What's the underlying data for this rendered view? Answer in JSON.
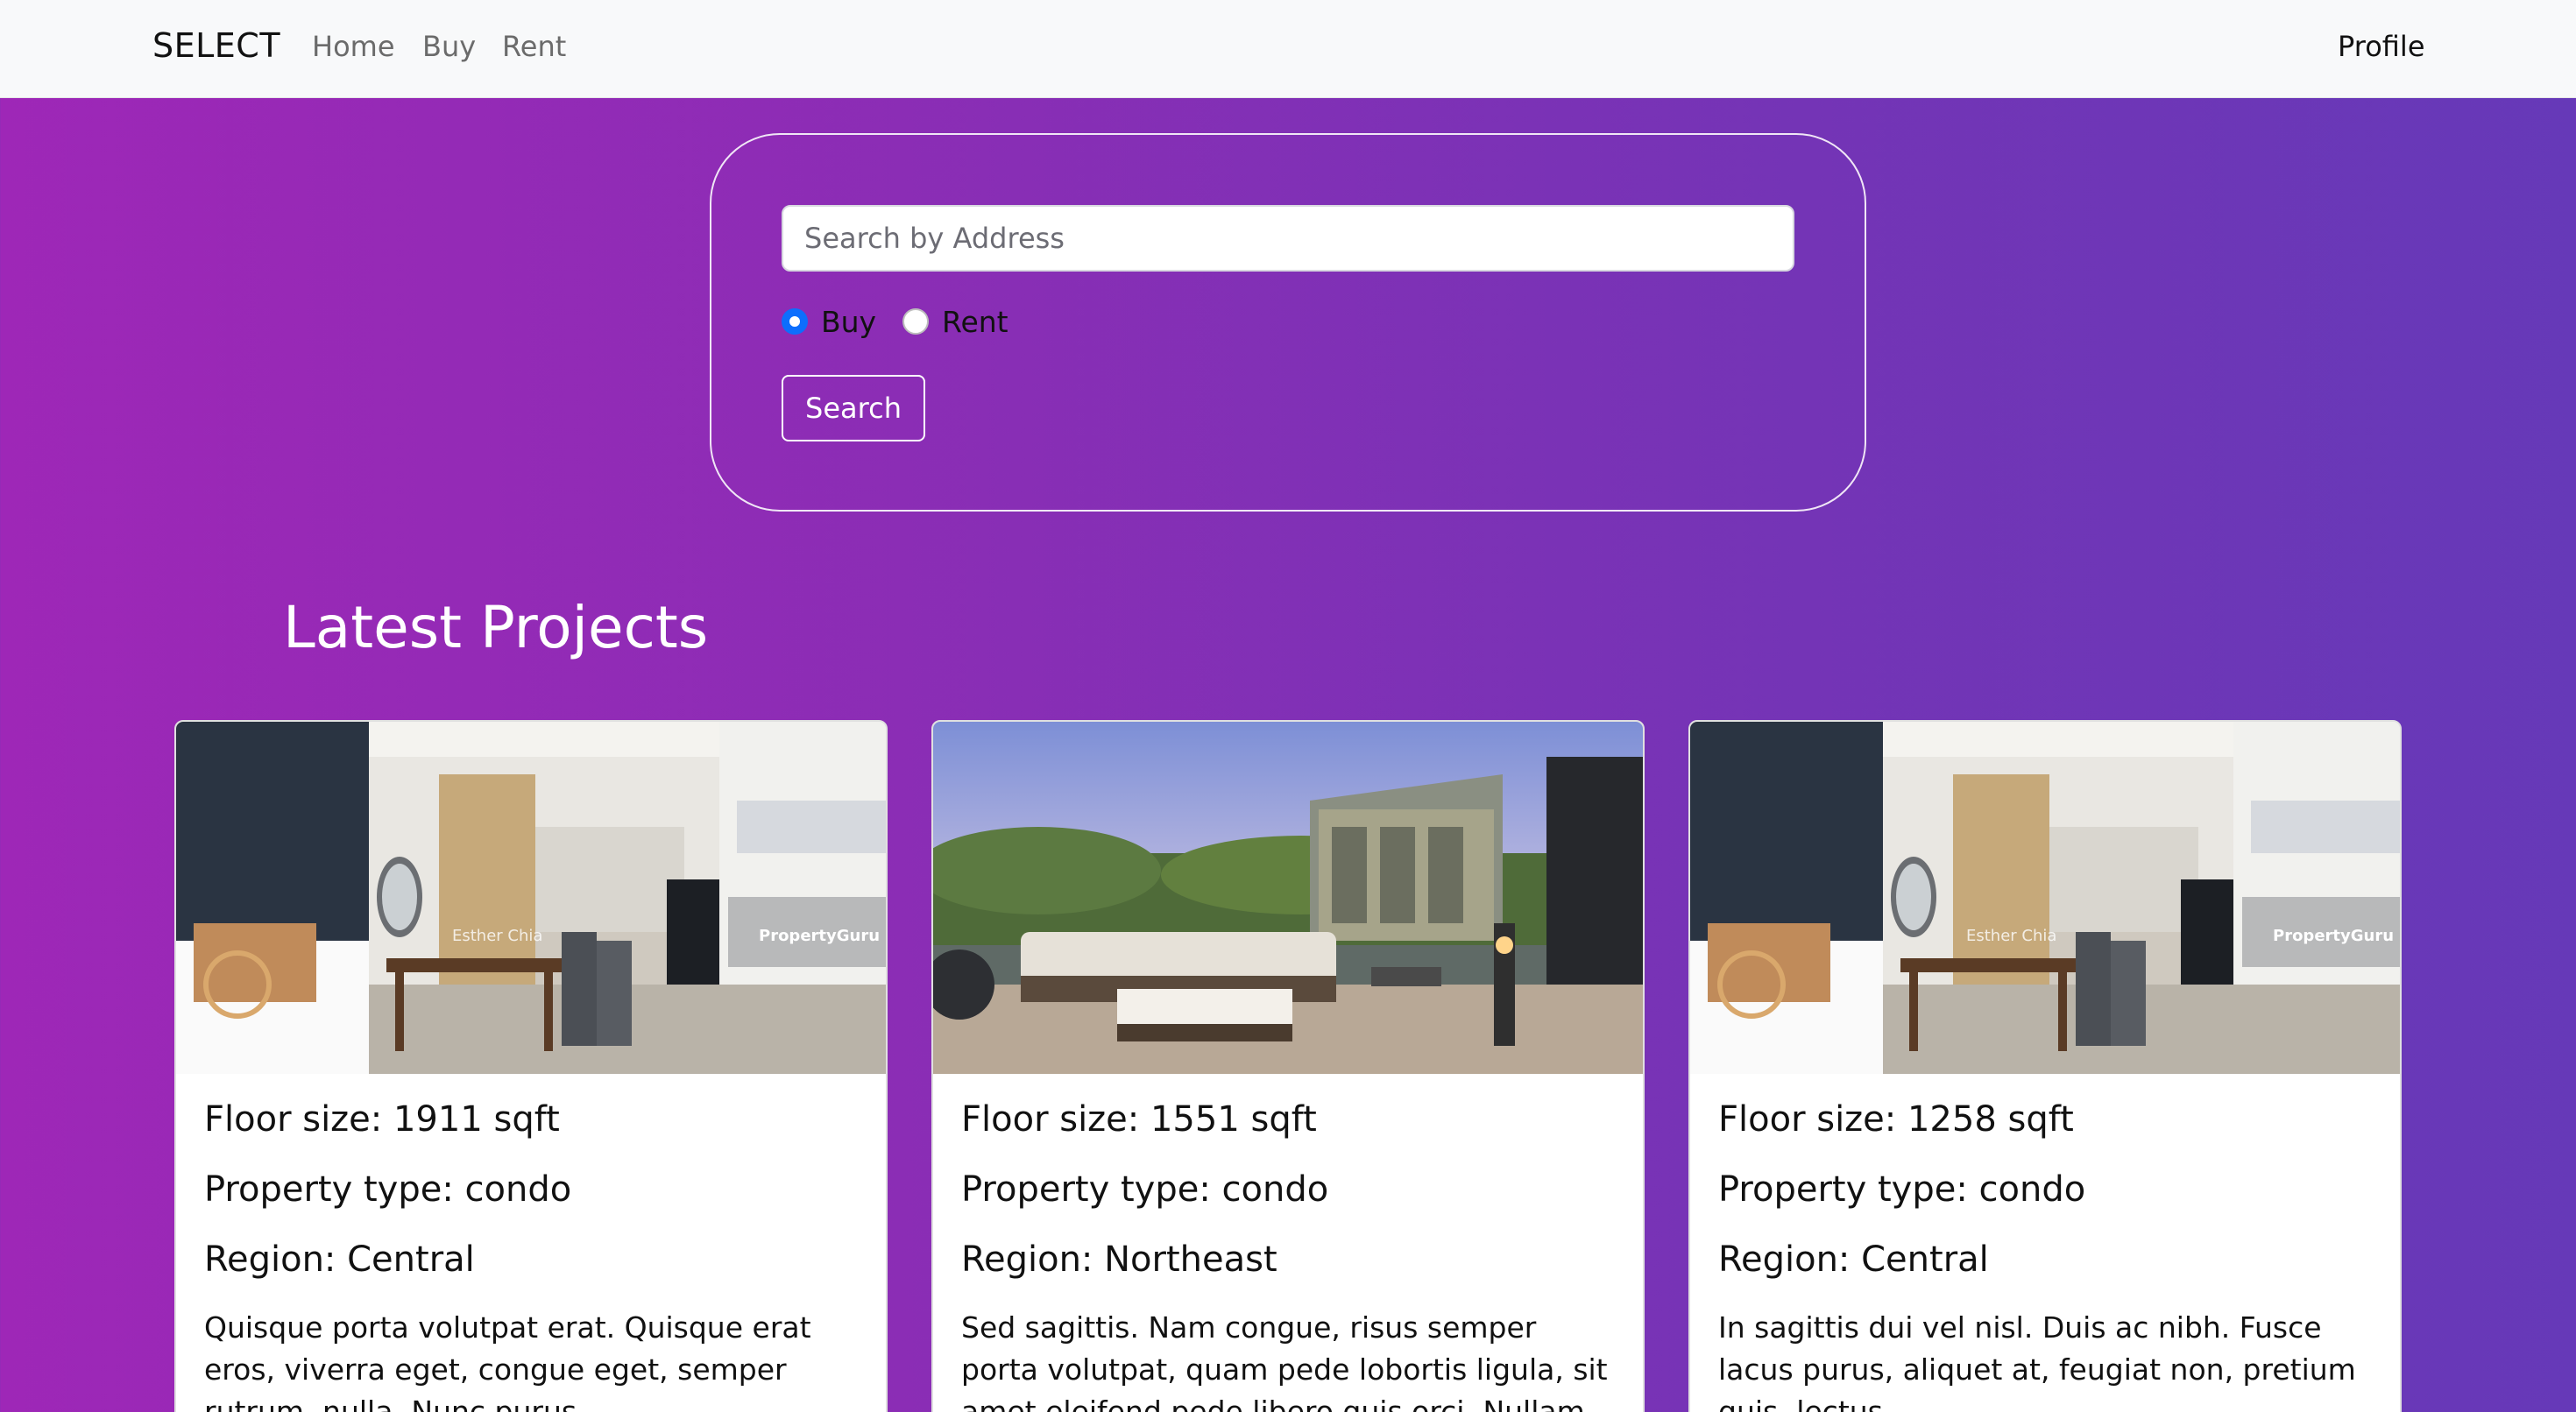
{
  "navbar": {
    "brand": "SELECT",
    "links": [
      "Home",
      "Buy",
      "Rent"
    ],
    "profile": "Profile"
  },
  "search": {
    "placeholder": "Search by Address",
    "options": [
      {
        "label": "Buy",
        "selected": true
      },
      {
        "label": "Rent",
        "selected": false
      }
    ],
    "button": "Search"
  },
  "section_title": "Latest Projects",
  "cards": [
    {
      "image": "interior-living-dining-photo",
      "watermark": "PropertyGuru",
      "floor_size": "Floor size: 1911 sqft",
      "property_type": "Property type: condo",
      "region": "Region: Central",
      "description": "Quisque porta volutpat erat. Quisque erat eros, viverra eget, congue eget, semper rutrum, nulla. Nunc purus."
    },
    {
      "image": "rooftop-terrace-rendering",
      "floor_size": "Floor size: 1551 sqft",
      "property_type": "Property type: condo",
      "region": "Region: Northeast",
      "description": "Sed sagittis. Nam congue, risus semper porta volutpat, quam pede lobortis ligula, sit amet eleifend pede libero quis orci. Nullam molestie"
    },
    {
      "image": "interior-living-dining-photo",
      "watermark": "PropertyGuru",
      "floor_size": "Floor size: 1258 sqft",
      "property_type": "Property type: condo",
      "region": "Region: Central",
      "description": "In sagittis dui vel nisl. Duis ac nibh. Fusce lacus purus, aliquet at, feugiat non, pretium quis, lectus."
    }
  ],
  "colors": {
    "background_gradient_start": "#9e27b7",
    "background_gradient_end": "#6639b8",
    "navbar_bg": "#f8f9fa",
    "radio_accent": "#0d6efd"
  }
}
